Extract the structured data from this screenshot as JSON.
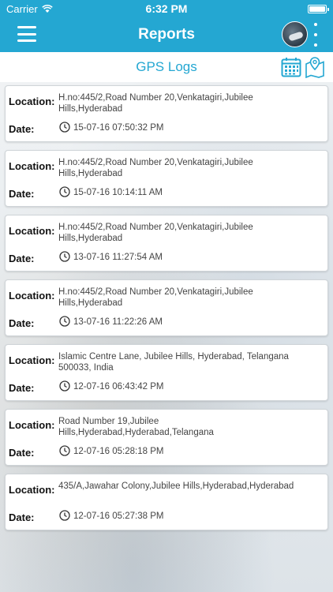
{
  "status_bar": {
    "carrier": "Carrier",
    "time": "6:32 PM"
  },
  "nav": {
    "title": "Reports"
  },
  "sub_header": {
    "title": "GPS Logs"
  },
  "labels": {
    "location": "Location:",
    "date": "Date:"
  },
  "logs": [
    {
      "location": "H.no:445/2,Road Number 20,Venkatagiri,Jubilee Hills,Hyderabad",
      "date": "15-07-16 07:50:32 PM"
    },
    {
      "location": "H.no:445/2,Road Number 20,Venkatagiri,Jubilee Hills,Hyderabad",
      "date": "15-07-16 10:14:11 AM"
    },
    {
      "location": "H.no:445/2,Road Number 20,Venkatagiri,Jubilee Hills,Hyderabad",
      "date": "13-07-16 11:27:54 AM"
    },
    {
      "location": "H.no:445/2,Road Number 20,Venkatagiri,Jubilee Hills,Hyderabad",
      "date": "13-07-16 11:22:26 AM"
    },
    {
      "location": "Islamic Centre Lane, Jubilee Hills, Hyderabad, Telangana 500033, India",
      "date": "12-07-16 06:43:42 PM"
    },
    {
      "location": "Road Number 19,Jubilee Hills,Hyderabad,Hyderabad,Telangana",
      "date": "12-07-16 05:28:18 PM"
    },
    {
      "location": "435/A,Jawahar Colony,Jubilee Hills,Hyderabad,Hyderabad",
      "date": "12-07-16 05:27:38 PM"
    }
  ],
  "colors": {
    "accent": "#24a7d2",
    "card_bg": "#ffffff"
  },
  "icons": {
    "menu": "hamburger-menu-icon",
    "more": "vertical-dots-icon",
    "calendar": "calendar-icon",
    "map": "map-pin-icon",
    "clock": "clock-icon"
  }
}
